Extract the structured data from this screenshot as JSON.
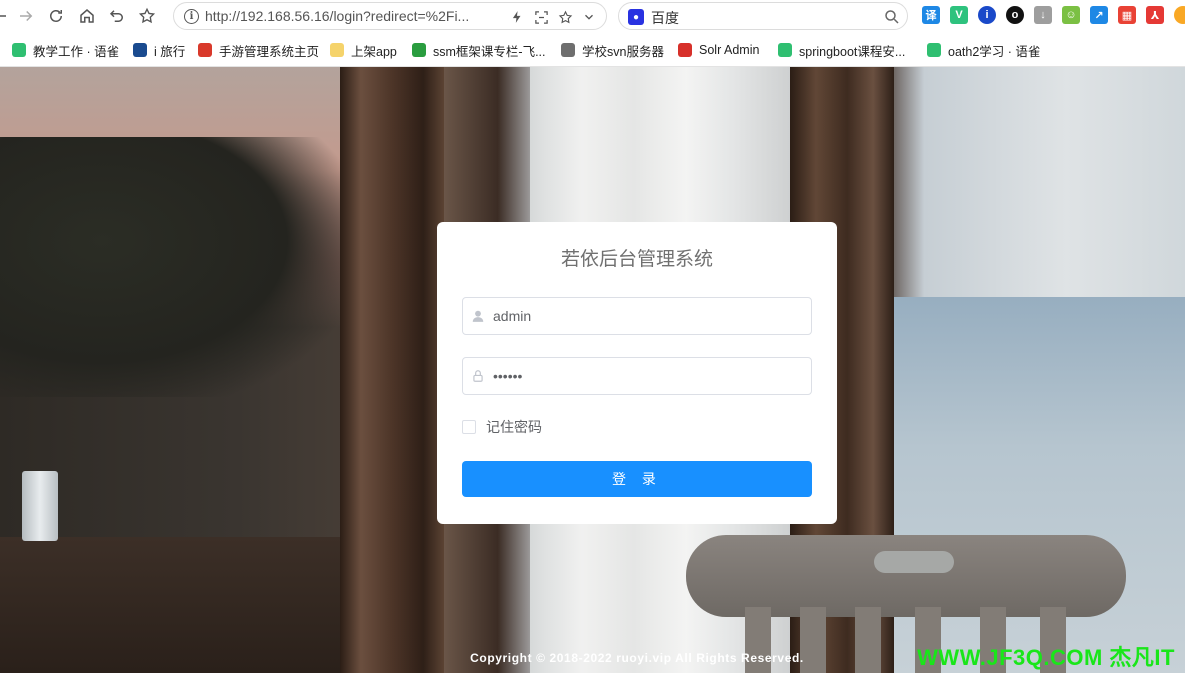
{
  "browser": {
    "url": "http://192.168.56.16/login?redirect=%2Fi...",
    "search_engine_label": "百度",
    "bookmarks": [
      {
        "label": "教学工作 · 语雀",
        "color": "#2fbf71"
      },
      {
        "label": "i 旅行",
        "color": "#1a4b8f"
      },
      {
        "label": "手游管理系统主页",
        "color": "#d9392b"
      },
      {
        "label": "上架app",
        "color": "#f5d36b"
      },
      {
        "label": "ssm框架课专栏-飞...",
        "color": "#2a9d3f"
      },
      {
        "label": "学校svn服务器",
        "color": "#6e6e6e"
      },
      {
        "label": "Solr Admin",
        "color": "#d7302a"
      },
      {
        "label": "springboot课程安...",
        "color": "#2fbf71"
      },
      {
        "label": "oath2学习 · 语雀",
        "color": "#2fbf71"
      }
    ],
    "extensions": [
      {
        "name": "translate-extension-icon",
        "text": "译",
        "color": "#1e88e5"
      },
      {
        "name": "vue-devtools-icon",
        "text": "V",
        "color": "#2ec27e"
      },
      {
        "name": "circle-blue-extension-icon",
        "text": "i",
        "color": "#1a49c9"
      },
      {
        "name": "circle-black-extension-icon",
        "text": "o",
        "color": "#111111"
      },
      {
        "name": "download-extension-icon",
        "text": "↓",
        "color": "#9e9e9e"
      },
      {
        "name": "frog-extension-icon",
        "text": "☺",
        "color": "#7bc043"
      },
      {
        "name": "arrow-blue-extension-icon",
        "text": "↗",
        "color": "#1e88e5"
      },
      {
        "name": "grid-extension-icon",
        "text": "▦",
        "color": "#e94235"
      },
      {
        "name": "pdf-extension-icon",
        "text": "⅄",
        "color": "#e53935"
      },
      {
        "name": "orange-extension-icon",
        "text": "",
        "color": "#f9a825"
      }
    ]
  },
  "login": {
    "title": "若依后台管理系统",
    "username_value": "admin",
    "password_value": "••••••",
    "remember_label": "记住密码",
    "login_button": "登 录"
  },
  "footer": {
    "copyright": "Copyright © 2018-2022 ruoyi.vip All Rights Reserved."
  },
  "watermark": "WWW.JF3Q.COM 杰凡IT",
  "colors": {
    "primary": "#1890ff",
    "watermark": "#19e619"
  }
}
